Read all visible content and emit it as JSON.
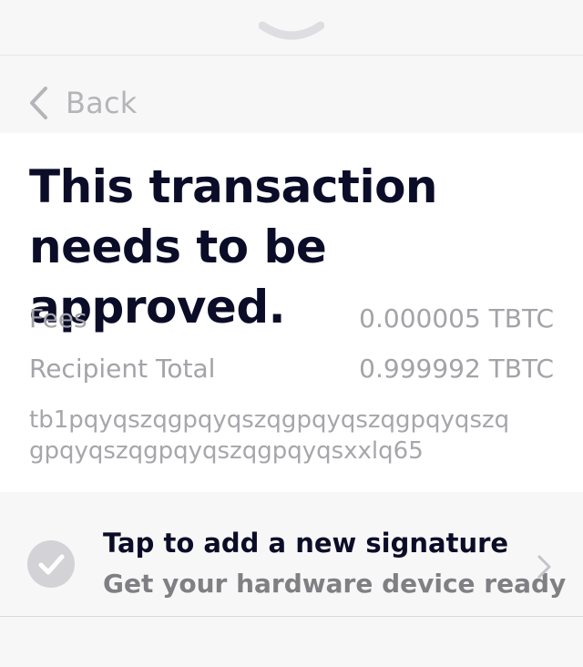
{
  "nav": {
    "back_label": "Back"
  },
  "transaction": {
    "title_line1": "This transaction",
    "title_line2": "needs to be approved.",
    "fees_label": "Fees",
    "fees_value": "0.000005 TBTC",
    "recipient_total_label": "Recipient Total",
    "recipient_total_value": "0.999992 TBTC",
    "address_line1": "tb1pqyqszqgpqyqszqgpqyqszqgpqyqszq",
    "address_line2": "gpqyqszqgpqyqszqgpqyqsxxlq65"
  },
  "signature": {
    "title": "Tap to add a new signature",
    "subtitle": "Get your hardware device ready"
  },
  "icons": {
    "grabber": "chevron-down-icon",
    "back": "chevron-left-icon",
    "check": "check-circle-icon",
    "disclosure": "chevron-right-icon"
  },
  "colors": {
    "title": "#0b0d28",
    "muted": "#a3a3a8",
    "background": "#f7f7f7",
    "card": "#ffffff"
  }
}
